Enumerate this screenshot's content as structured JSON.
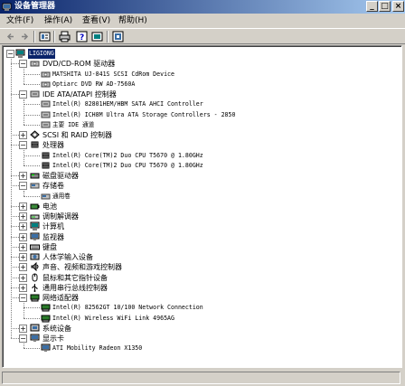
{
  "window": {
    "title": "设备管理器",
    "min": "_",
    "max": "□",
    "close": "×"
  },
  "menu": [
    "文件(F)",
    "操作(A)",
    "查看(V)",
    "帮助(H)"
  ],
  "toolbar": [
    "back-icon",
    "forward-icon",
    "properties-icon",
    "print-icon",
    "help-icon",
    "refresh-icon",
    "scan-hardware-icon"
  ],
  "tree": {
    "root": "LIGIONG",
    "categories": [
      {
        "label": "DVD/CD-ROM 驱动器",
        "expanded": true,
        "icon": "cdrom-icon",
        "children": [
          "MATSHITA UJ-841S SCSI CdRom Device",
          "Optiarc DVD RW AD-7560A"
        ]
      },
      {
        "label": "IDE ATA/ATAPI 控制器",
        "expanded": true,
        "icon": "ide-controller-icon",
        "children": [
          "Intel(R) 82801HEM/HBM SATA AHCI Controller",
          "Intel(R) ICH8M Ultra ATA Storage Controllers - 2850",
          "主要 IDE 通道"
        ]
      },
      {
        "label": "SCSI 和 RAID 控制器",
        "expanded": false,
        "icon": "scsi-icon",
        "children": []
      },
      {
        "label": "处理器",
        "expanded": true,
        "icon": "processor-icon",
        "children": [
          "Intel(R) Core(TM)2 Duo CPU     T5670  @ 1.80GHz",
          "Intel(R) Core(TM)2 Duo CPU     T5670  @ 1.80GHz"
        ]
      },
      {
        "label": "磁盘驱动器",
        "expanded": false,
        "icon": "disk-icon",
        "children": []
      },
      {
        "label": "存储卷",
        "expanded": true,
        "icon": "storage-volume-icon",
        "children": [
          "通用卷"
        ]
      },
      {
        "label": "电池",
        "expanded": false,
        "icon": "battery-icon",
        "children": []
      },
      {
        "label": "调制解调器",
        "expanded": false,
        "icon": "modem-icon",
        "children": []
      },
      {
        "label": "计算机",
        "expanded": false,
        "icon": "computer-icon",
        "children": []
      },
      {
        "label": "监视器",
        "expanded": false,
        "icon": "monitor-icon",
        "children": []
      },
      {
        "label": "键盘",
        "expanded": false,
        "icon": "keyboard-icon",
        "children": []
      },
      {
        "label": "人体学输入设备",
        "expanded": false,
        "icon": "hid-icon",
        "children": []
      },
      {
        "label": "声音、视频和游戏控制器",
        "expanded": false,
        "icon": "sound-icon",
        "children": []
      },
      {
        "label": "鼠标和其它指针设备",
        "expanded": false,
        "icon": "mouse-icon",
        "children": []
      },
      {
        "label": "通用串行总线控制器",
        "expanded": false,
        "icon": "usb-icon",
        "children": []
      },
      {
        "label": "网络适配器",
        "expanded": true,
        "icon": "network-icon",
        "children": [
          "Intel(R) 82562GT 10/100 Network Connection",
          "Intel(R) Wireless WiFi Link 4965AG"
        ]
      },
      {
        "label": "系统设备",
        "expanded": false,
        "icon": "system-icon",
        "children": []
      },
      {
        "label": "显示卡",
        "expanded": true,
        "icon": "display-icon",
        "children": [
          "ATI Mobility Radeon X1350"
        ]
      }
    ]
  },
  "colors": {
    "titlebar_start": "#0a246a",
    "titlebar_end": "#a6caf0",
    "face": "#d4d0c8",
    "selection": "#0a246a"
  }
}
